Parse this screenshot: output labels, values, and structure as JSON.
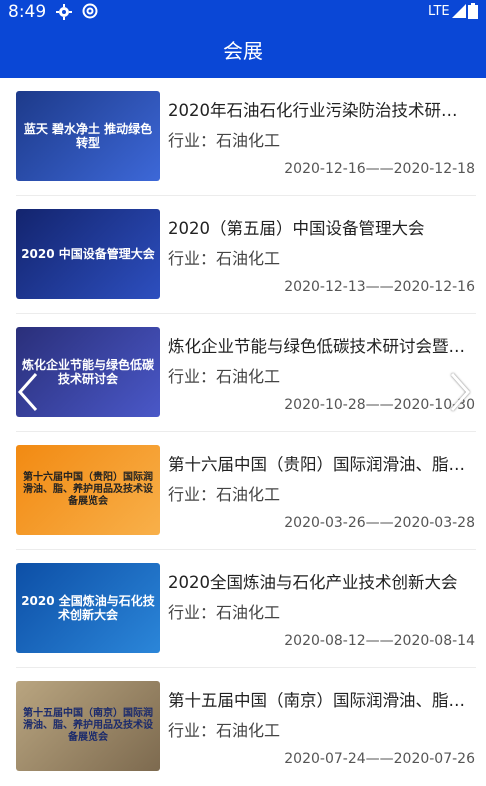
{
  "status_bar": {
    "time": "8:49",
    "network": "LTE",
    "icons": [
      "gear-icon",
      "at-icon",
      "signal-icon",
      "battery-icon"
    ]
  },
  "app_bar": {
    "title": "会展"
  },
  "industry_prefix": "行业：",
  "colors": {
    "primary": "#0a47d6"
  },
  "items": [
    {
      "title": "2020年石油石化行业污染防治技术研讨…",
      "industry": "石油化工",
      "dates": "2020-12-16——2020-12-18",
      "thumb_text": "蓝天 碧水净土 推动绿色转型",
      "thumb_color": "#1d3a8a"
    },
    {
      "title": "2020（第五届）中国设备管理大会",
      "industry": "石油化工",
      "dates": "2020-12-13——2020-12-16",
      "thumb_text": "2020 中国设备管理大会",
      "thumb_color": "#1a2f86"
    },
    {
      "title": "炼化企业节能与绿色低碳技术研讨会暨…",
      "industry": "石油化工",
      "dates": "2020-10-28——2020-10-30",
      "thumb_text": "炼化企业节能与绿色低碳技术研讨会",
      "thumb_color": "#2a2f7a"
    },
    {
      "title": "第十六届中国（贵阳）国际润滑油、脂…",
      "industry": "石油化工",
      "dates": "2020-03-26——2020-03-28",
      "thumb_text": "第十六届中国（贵阳）国际润滑油、脂、养护用品及技术设备展览会",
      "thumb_color": "#f59a1f"
    },
    {
      "title": "2020全国炼油与石化产业技术创新大会",
      "industry": "石油化工",
      "dates": "2020-08-12——2020-08-14",
      "thumb_text": "2020 全国炼油与石化技术创新大会",
      "thumb_color": "#1260b8"
    },
    {
      "title": "第十五届中国（南京）国际润滑油、脂…",
      "industry": "石油化工",
      "dates": "2020-07-24——2020-07-26",
      "thumb_text": "第十五届中国（南京）国际润滑油、脂、养护用品及技术设备展览会",
      "thumb_color": "#9f8b6a"
    }
  ]
}
